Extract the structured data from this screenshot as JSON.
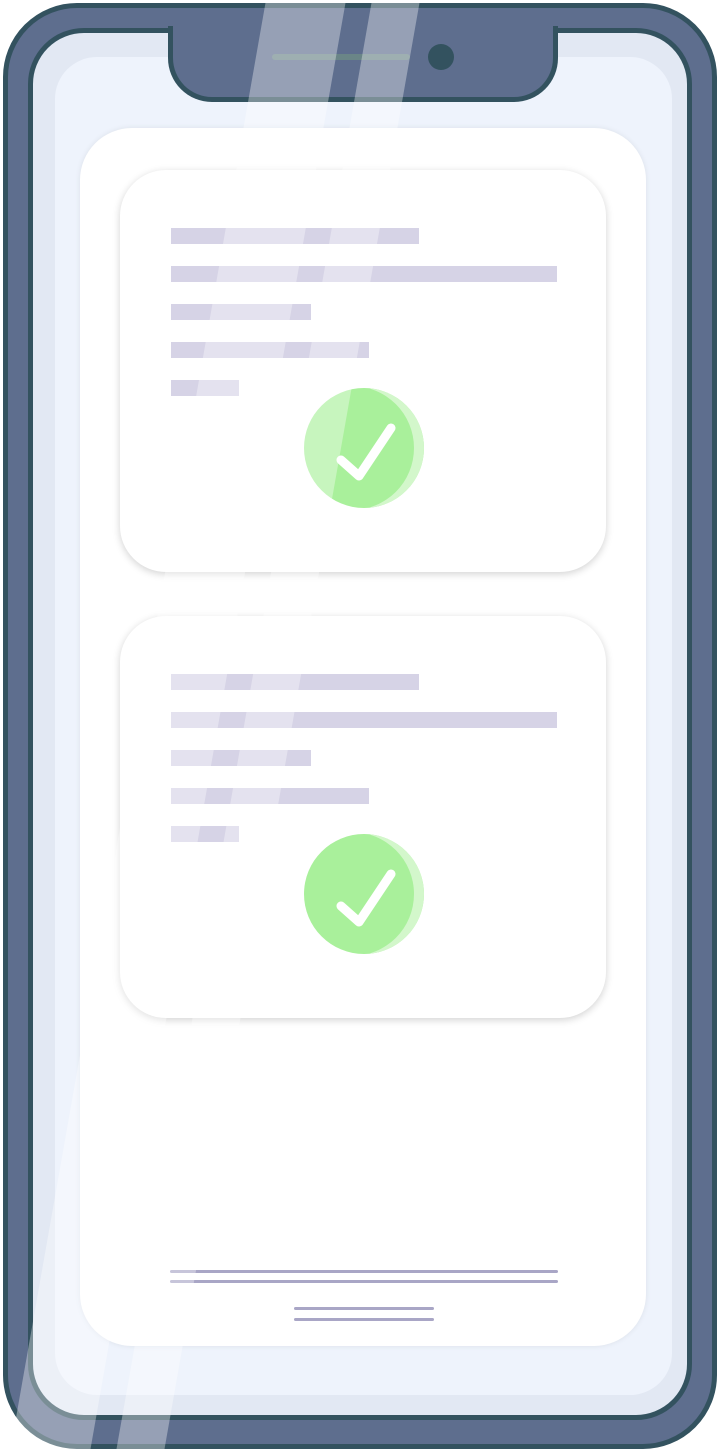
{
  "colors": {
    "frame": "#5e6e8e",
    "frame_outline": "#33525f",
    "screen": "#eef3fc",
    "card": "#ffffff",
    "placeholder_line": "#d6d3e6",
    "check_green": "#a9f09b",
    "check_mark": "#ffffff",
    "home_indicator": "#a9a6c6"
  },
  "icons": {
    "check": "check-circle-icon",
    "camera": "camera-icon",
    "speaker": "speaker-grille"
  },
  "cards": [
    {
      "status": "completed",
      "placeholder_lines": 5
    },
    {
      "status": "completed",
      "placeholder_lines": 5
    }
  ]
}
